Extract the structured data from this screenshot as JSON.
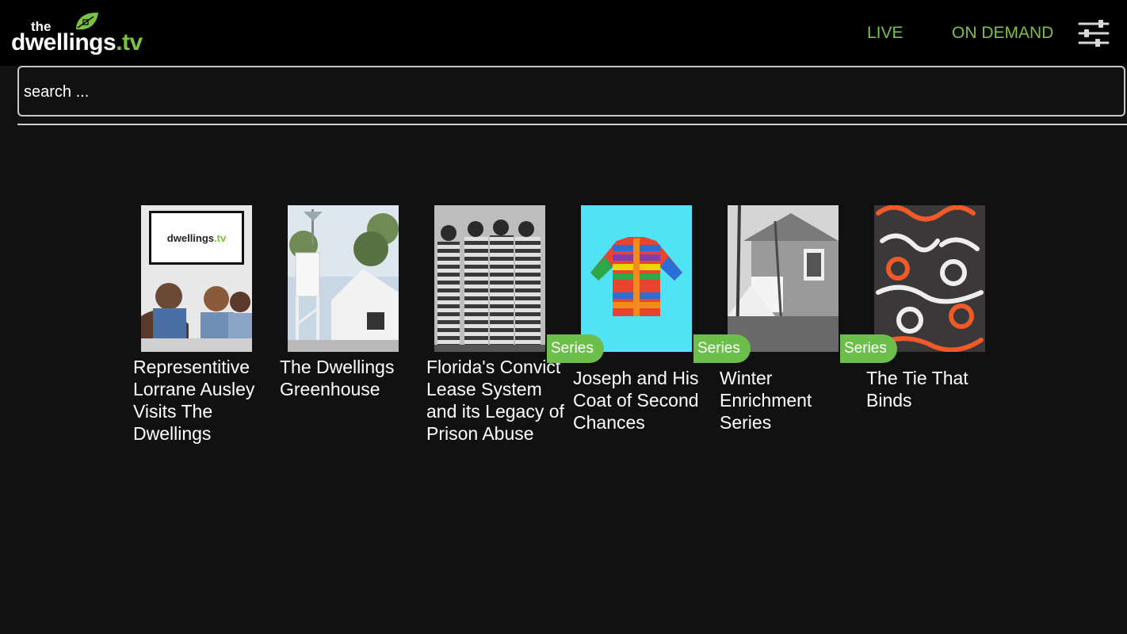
{
  "header": {
    "logo_the": "the",
    "logo_word": "dwellings",
    "logo_tld": ".tv",
    "nav": [
      {
        "label": "LIVE"
      },
      {
        "label": "ON DEMAND"
      }
    ],
    "accent_color": "#7cc142"
  },
  "search": {
    "placeholder": "search ..."
  },
  "cards": [
    {
      "title": "Representitive Lorrane Ausley Visits The Dwellings",
      "badge": ""
    },
    {
      "title": "The Dwellings Greenhouse",
      "badge": ""
    },
    {
      "title": "Florida's Convict Lease System and its Legacy of Prison Abuse",
      "badge": ""
    },
    {
      "title": "Joseph and His Coat of Second Chances",
      "badge": "Series"
    },
    {
      "title": "Winter Enrichment Series",
      "badge": "Series"
    },
    {
      "title": "The Tie That Binds",
      "badge": "Series"
    }
  ],
  "icons": {
    "filter": "sliders-icon",
    "logo_leaf": "leaf-icon"
  }
}
